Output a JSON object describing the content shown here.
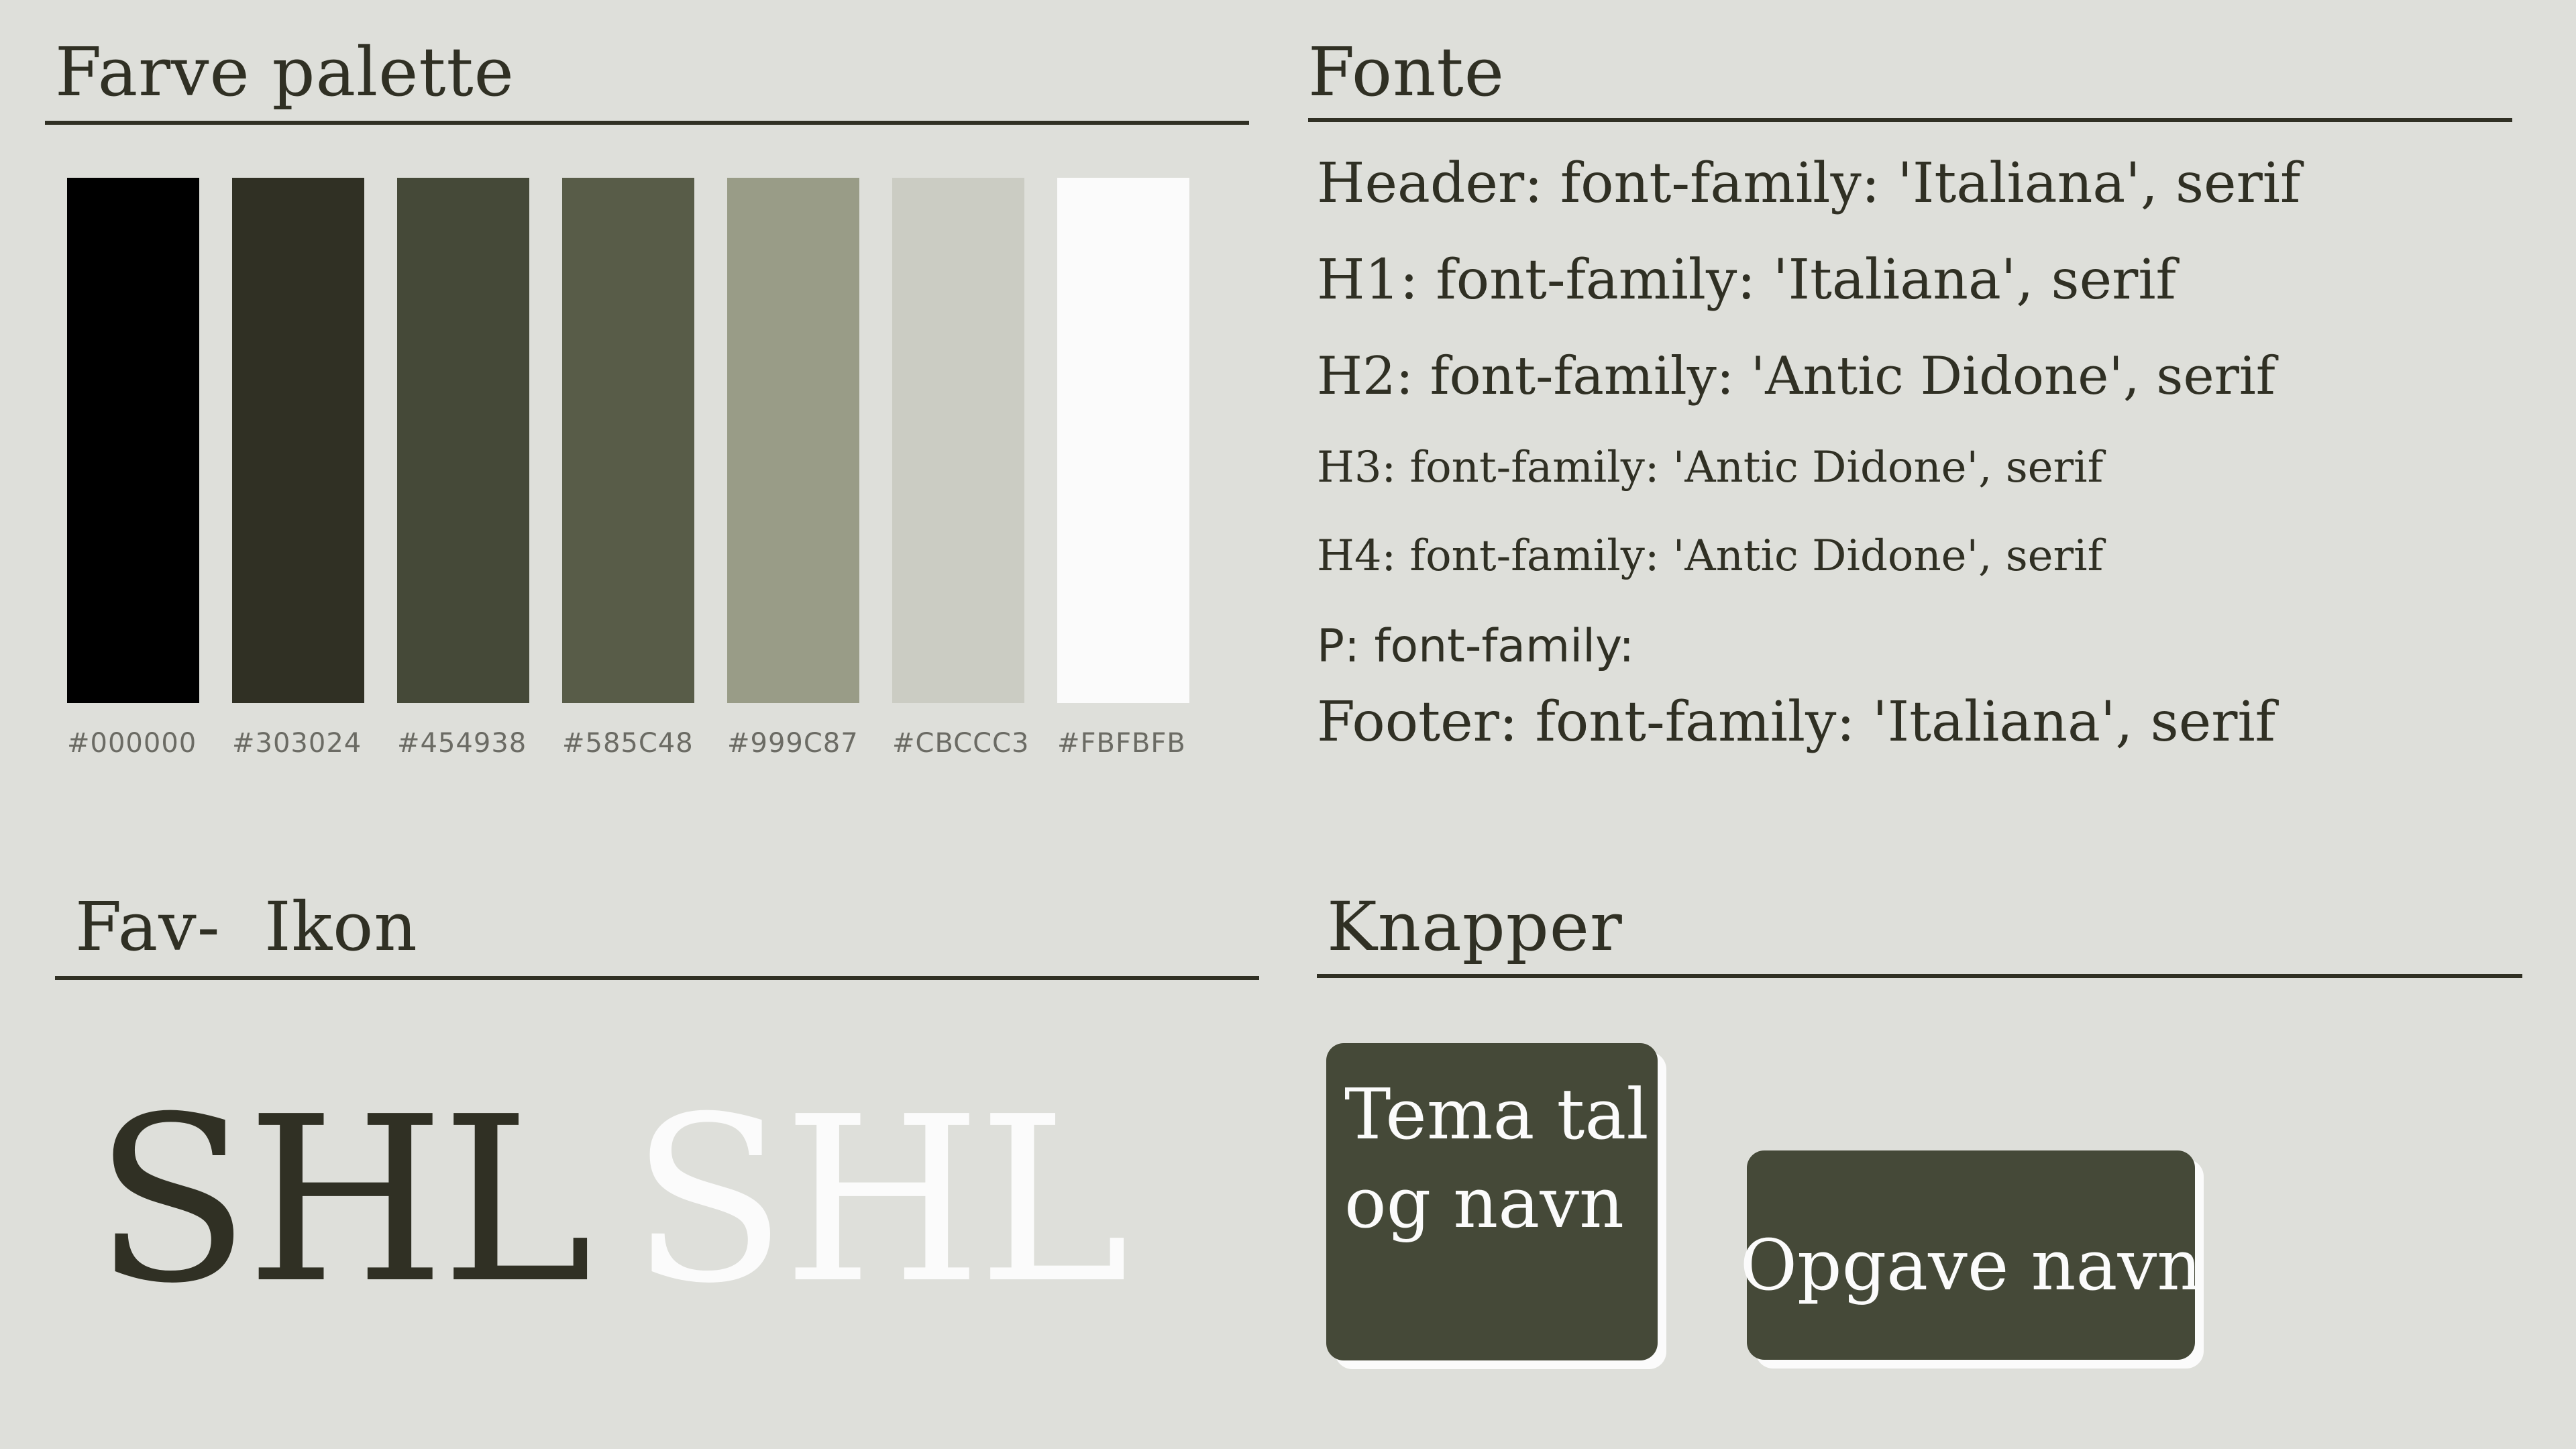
{
  "palette": {
    "title": "Farve palette",
    "swatches": [
      {
        "hex": "#000000",
        "label": "#000000"
      },
      {
        "hex": "#303024",
        "label": "#303024"
      },
      {
        "hex": "#454938",
        "label": "#454938"
      },
      {
        "hex": "#585C48",
        "label": "#585C48"
      },
      {
        "hex": "#999C87",
        "label": "#999C87"
      },
      {
        "hex": "#CBCCC3",
        "label": "#CBCCC3"
      },
      {
        "hex": "#FBFBFB",
        "label": "#FBFBFB"
      }
    ]
  },
  "fonts": {
    "title": "Fonte",
    "lines": [
      "Header: font-family: 'Italiana', serif",
      "H1: font-family: 'Italiana', serif",
      "H2: font-family: 'Antic Didone', serif",
      "H3: font-family: 'Antic Didone', serif",
      "H4: font-family: 'Antic Didone', serif",
      "P: font-family:",
      "Footer: font-family: 'Italiana', serif"
    ]
  },
  "favicon": {
    "title": "Fav-  Ikon",
    "dark_text": "SHL",
    "light_text": "SHL",
    "dark_color": "#303024",
    "light_color": "#FBFBFB"
  },
  "buttons": {
    "title": "Knapper",
    "primary_label_line1": "Tema tal",
    "primary_label_line2": "og navn",
    "secondary_label": "Opgave navn",
    "fill_color": "#454938",
    "text_color": "#FBFBFB"
  }
}
